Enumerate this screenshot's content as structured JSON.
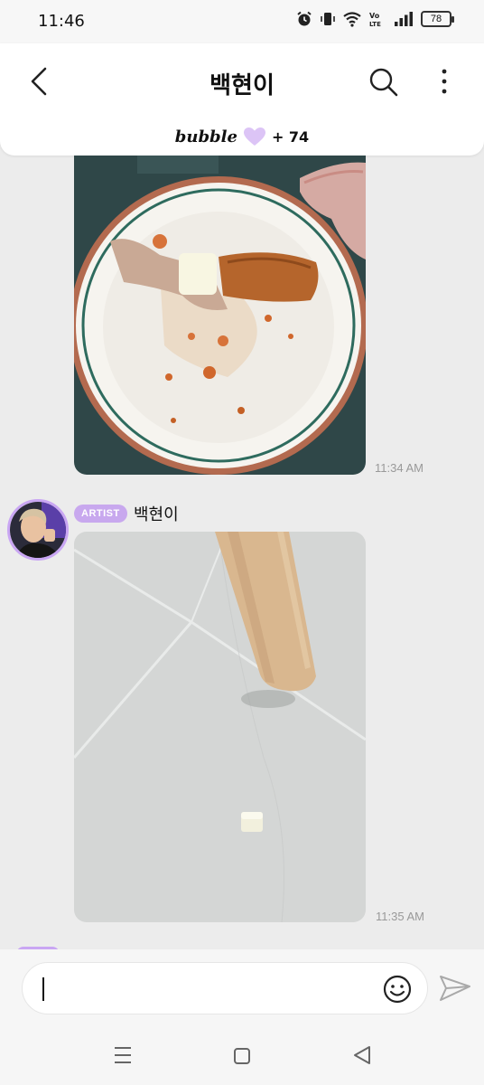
{
  "status_bar": {
    "time": "11:46",
    "volte_label": "Vo LTE",
    "battery": "78"
  },
  "header": {
    "title": "백현이",
    "bubble_label": "bubble",
    "bubble_count": "+ 74"
  },
  "messages": [
    {
      "type": "image",
      "description_icon": "photo-plate-chicken",
      "time": "11:34 AM"
    },
    {
      "type": "image",
      "description_icon": "photo-floor-cube",
      "time": "11:35 AM"
    }
  ],
  "sender": {
    "badge": "ARTIST",
    "name": "백현이"
  },
  "input": {
    "value": ""
  },
  "colors": {
    "accent": "#c8a8ee",
    "background": "#ececec"
  }
}
